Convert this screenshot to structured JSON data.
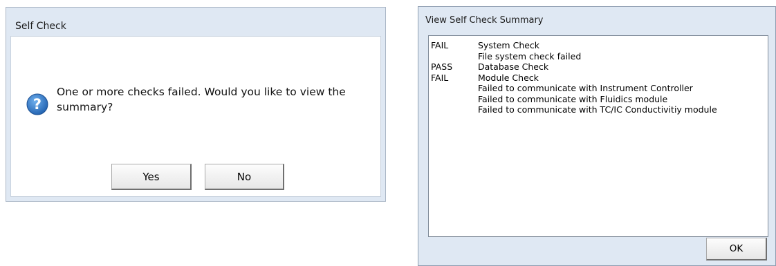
{
  "self_check_dialog": {
    "title": "Self Check",
    "message": "One or more checks failed.  Would you like to view the summary?",
    "yes_label": "Yes",
    "no_label": "No",
    "icon": "question-icon"
  },
  "summary_dialog": {
    "title": "View Self Check Summary",
    "rows": [
      {
        "status": "FAIL",
        "text": "System Check"
      },
      {
        "status": "",
        "text": "File system check failed"
      },
      {
        "status": "PASS",
        "text": "Database Check"
      },
      {
        "status": "FAIL",
        "text": "Module Check"
      },
      {
        "status": "",
        "text": "Failed to communicate with Instrument Controller"
      },
      {
        "status": "",
        "text": "Failed to communicate with Fluidics module"
      },
      {
        "status": "",
        "text": "Failed to communicate with TC/IC Conductivitiy module"
      }
    ],
    "ok_label": "OK"
  },
  "colors": {
    "frame": "#dfe8f3",
    "question_icon": "#2a6fc0"
  }
}
